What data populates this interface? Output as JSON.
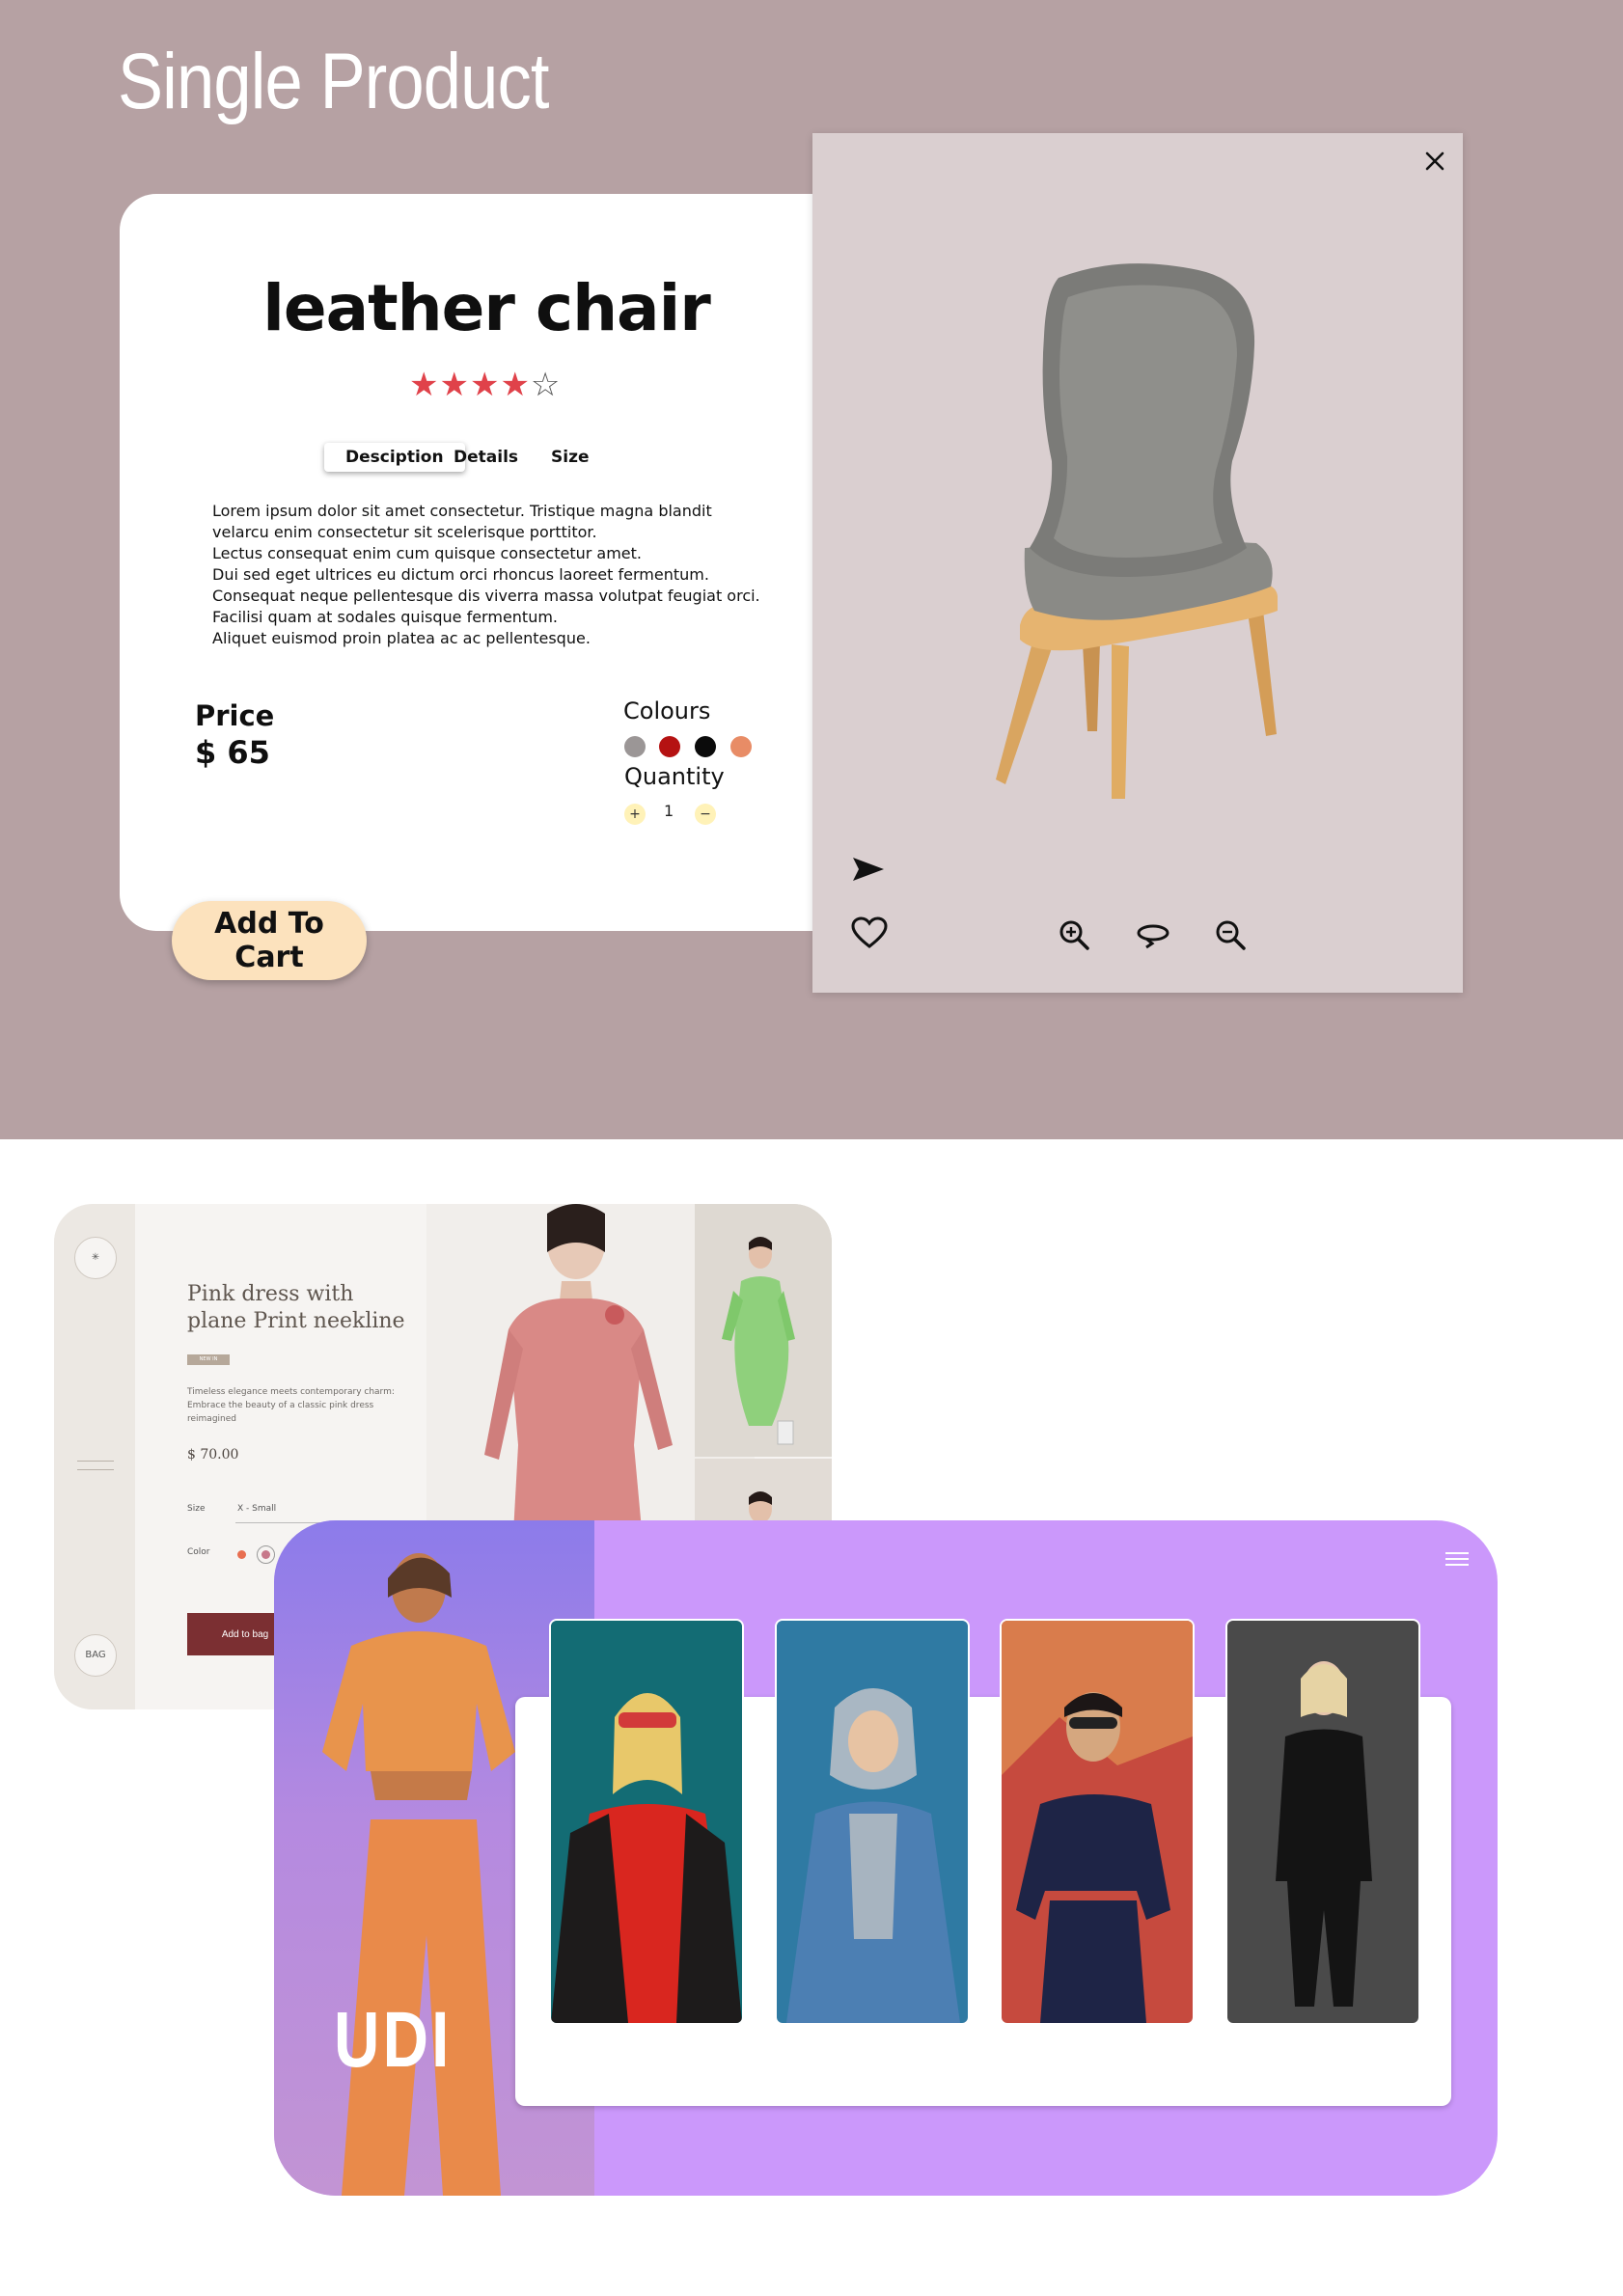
{
  "page": {
    "heading": "Single Product"
  },
  "product": {
    "title": "leather chair",
    "rating": {
      "value": 4,
      "max": 5,
      "full_stars": "★★★★",
      "empty_stars": "☆"
    },
    "tabs": [
      {
        "label": "Desciption",
        "active": true
      },
      {
        "label": "Details",
        "active": false
      },
      {
        "label": "Size",
        "active": false
      }
    ],
    "description": [
      "Lorem ipsum dolor sit amet consectetur. Tristique magna blandit",
      "velarcu enim consectetur sit scelerisque porttitor.",
      "Lectus consequat enim cum quisque consectetur amet.",
      "Dui sed eget ultrices eu dictum orci rhoncus laoreet fermentum.",
      "Consequat neque pellentesque dis viverra massa volutpat feugiat orci.",
      "Facilisi quam at sodales quisque fermentum.",
      "Aliquet euismod proin platea ac ac pellentesque."
    ],
    "price_label": "Price",
    "price_value": "$ 65",
    "colours_label": "Colours",
    "colours": [
      "#9b9696",
      "#b51212",
      "#0b0b0b",
      "#e88c66"
    ],
    "quantity_label": "Quantity",
    "quantity_plus": "+",
    "quantity_value": "1",
    "quantity_minus": "−",
    "add_to_cart": "Add To Cart",
    "icons": [
      "close-icon",
      "send-icon",
      "heart-icon",
      "zoom-in-icon",
      "rotate-icon",
      "zoom-out-icon"
    ]
  },
  "fashion": {
    "title": "Pink dress with plane Print neekline",
    "tag": "NEW IN",
    "description": "Timeless elegance meets contemporary charm: Embrace the beauty of a classic pink dress reimagined",
    "price": "$ 70.00",
    "size_label": "Size",
    "size_value": "X - Small",
    "color_label": "Color",
    "color_options": [
      "#e86e50",
      "#c7788a"
    ],
    "add_button": "Add to bag",
    "bag_label": "BAG",
    "accent": "#7b2f32"
  },
  "udi": {
    "logo": "UDI",
    "accent": "#cb98fb"
  }
}
